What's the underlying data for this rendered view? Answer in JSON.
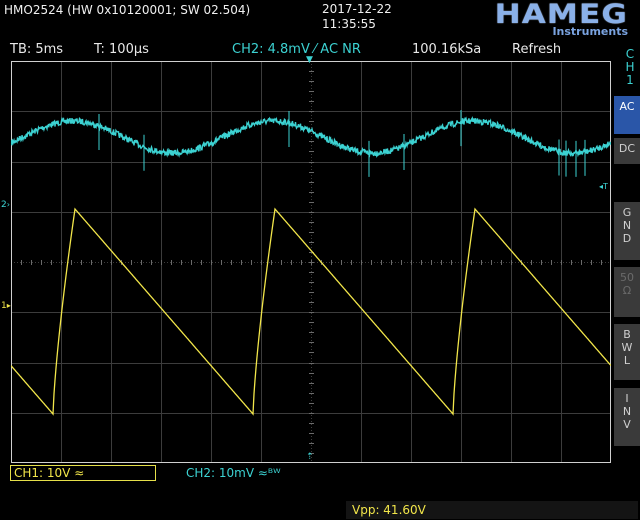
{
  "header": {
    "device_info": "HMO2524 (HW 0x10120001; SW 02.504)",
    "date": "2017-12-22",
    "time": "11:35:55",
    "logo": "HAMEG",
    "logo_sub": "Instruments"
  },
  "status": {
    "timebase": "TB: 5ms",
    "trigger_time": "T: 100µs",
    "ch2": "CH2: 4.8mV ⁄ AC NR",
    "sample_rate": "100.16kSa",
    "mode": "Refresh"
  },
  "side_panel": {
    "channel": [
      "C",
      "H",
      "1"
    ],
    "buttons": [
      {
        "lines": [
          "AC"
        ],
        "active": true,
        "dim": false
      },
      {
        "lines": [
          "DC"
        ],
        "active": false,
        "dim": false
      },
      {
        "lines": [
          "G",
          "N",
          "D"
        ],
        "active": false,
        "dim": false
      },
      {
        "lines": [
          "50",
          "Ω"
        ],
        "active": false,
        "dim": true
      },
      {
        "lines": [
          "B",
          "W",
          "L"
        ],
        "active": false,
        "dim": false
      },
      {
        "lines": [
          "I",
          "N",
          "V"
        ],
        "active": false,
        "dim": false
      }
    ]
  },
  "footer": {
    "ch1": "CH1: 10V ≈",
    "ch2": "CH2: 10mV ≈ᴮᵂ",
    "vpp": "Vpp: 41.60V"
  },
  "markers": {
    "ch2_marker": "2",
    "ch1_marker": "1",
    "trigger_marker": "T"
  },
  "colors": {
    "ch1": "#f2e64a",
    "ch2": "#3cd2d2",
    "grid": "#3c3c3c",
    "accent": "#2a56a8"
  },
  "waveforms": {
    "ch1": {
      "shape": "sawtooth",
      "periods_visible": 3
    },
    "ch2": {
      "shape": "sine-noisy",
      "periods_visible": 3
    }
  }
}
